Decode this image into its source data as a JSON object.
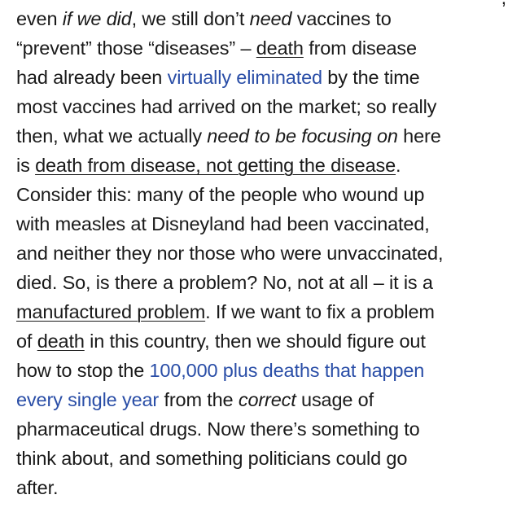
{
  "article": {
    "top_fragment": ",",
    "lines": [
      [
        {
          "text": "even ",
          "style": "plain"
        },
        {
          "text": "if we did",
          "style": "italic"
        },
        {
          "text": ", we still don’t ",
          "style": "plain"
        },
        {
          "text": "need",
          "style": "italic"
        },
        {
          "text": " vaccines to",
          "style": "plain"
        }
      ],
      [
        {
          "text": "“prevent” those “diseases” – ",
          "style": "plain"
        },
        {
          "text": "death",
          "style": "underline"
        },
        {
          "text": " from disease",
          "style": "plain"
        }
      ],
      [
        {
          "text": "had already been ",
          "style": "plain"
        },
        {
          "text": "virtually eliminated",
          "style": "link"
        },
        {
          "text": " by the time",
          "style": "plain"
        }
      ],
      [
        {
          "text": "most vaccines had arrived on the market; so really",
          "style": "plain"
        }
      ],
      [
        {
          "text": "then, what we actually ",
          "style": "plain"
        },
        {
          "text": "need to be focusing on",
          "style": "italic"
        },
        {
          "text": " here",
          "style": "plain"
        }
      ],
      [
        {
          "text": "is ",
          "style": "plain"
        },
        {
          "text": "death from disease, not getting the disease",
          "style": "underline"
        },
        {
          "text": ".",
          "style": "plain"
        }
      ],
      [
        {
          "text": "Consider this: many of the people who wound up",
          "style": "plain"
        }
      ],
      [
        {
          "text": "with measles at Disneyland had been vaccinated,",
          "style": "plain"
        }
      ],
      [
        {
          "text": "and neither they nor those who were unvaccinated,",
          "style": "plain"
        }
      ],
      [
        {
          "text": "died. So, is there a problem? No, not at all – it is a",
          "style": "plain"
        }
      ],
      [
        {
          "text": "manufactured problem",
          "style": "underline"
        },
        {
          "text": ". If we want to fix a problem",
          "style": "plain"
        }
      ],
      [
        {
          "text": "of ",
          "style": "plain"
        },
        {
          "text": "death",
          "style": "underline"
        },
        {
          "text": " in this country, then we should figure out",
          "style": "plain"
        }
      ],
      [
        {
          "text": "how to stop the ",
          "style": "plain"
        },
        {
          "text": "100,000 plus deaths that happen",
          "style": "link"
        }
      ],
      [
        {
          "text": "every single year",
          "style": "link"
        },
        {
          "text": " from the ",
          "style": "plain"
        },
        {
          "text": "correct",
          "style": "italic"
        },
        {
          "text": " usage of",
          "style": "plain"
        }
      ],
      [
        {
          "text": "pharmaceutical drugs. Now there’s something to",
          "style": "plain"
        }
      ],
      [
        {
          "text": "think about, and something politicians could go",
          "style": "plain"
        }
      ],
      [
        {
          "text": "after.",
          "style": "plain"
        }
      ]
    ]
  }
}
